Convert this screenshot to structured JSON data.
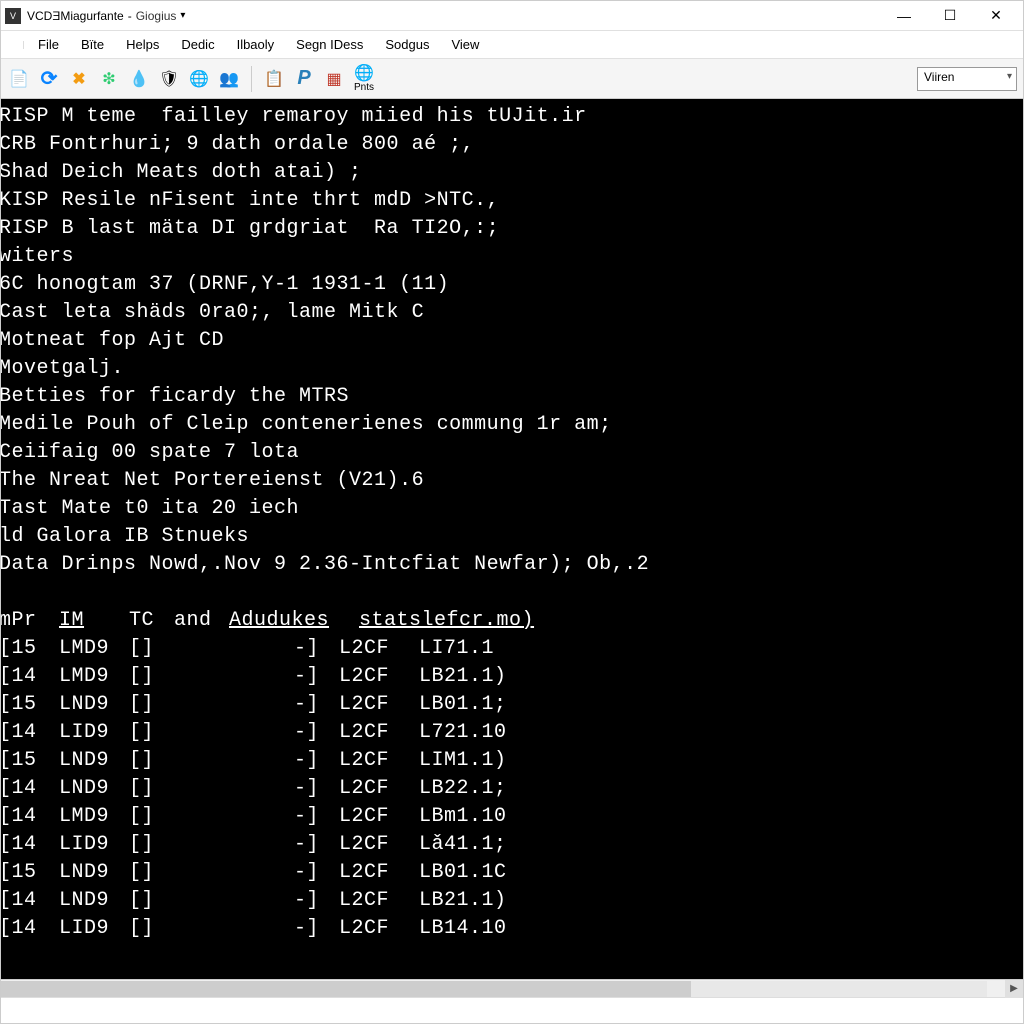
{
  "titlebar": {
    "app_icon_letter": "V",
    "title": "VCDƎMiagurfante",
    "subtitle": "Giogius",
    "caret": "▾"
  },
  "menubar": {
    "items": [
      "",
      "File",
      "Bïte",
      "Helps",
      "Dedic",
      "Ilbaoly",
      "Segn IDess",
      "Sodgus",
      "View"
    ]
  },
  "toolbar": {
    "icons": [
      {
        "name": "new-doc-icon",
        "glyph": "📄",
        "color": "#2a7"
      },
      {
        "name": "refresh-icon",
        "glyph": "⟳",
        "color": "#0a84ff"
      },
      {
        "name": "close-x-icon",
        "glyph": "✖",
        "color": "#f39c12"
      },
      {
        "name": "leaf-icon",
        "glyph": "❇",
        "color": "#2ecc71"
      },
      {
        "name": "drop-icon",
        "glyph": "💧",
        "color": "#3498db"
      },
      {
        "name": "shield-icon",
        "glyph": "🛡",
        "color": "#95a5a6"
      },
      {
        "name": "globe-icon",
        "glyph": "🌐",
        "color": "#8e44ad"
      },
      {
        "name": "people-icon",
        "glyph": "👥",
        "color": "#e67e22"
      }
    ],
    "icons2": [
      {
        "name": "calendar-icon",
        "glyph": "📋",
        "color": "#2980b9"
      },
      {
        "name": "p-icon",
        "glyph": "P",
        "color": "#2980b9"
      },
      {
        "name": "grid-icon",
        "glyph": "▦",
        "color": "#c0392b"
      }
    ],
    "prints_label": "Pnts",
    "prints_icon": "🌐",
    "select_value": "Viiren"
  },
  "terminal": {
    "lines": [
      "RISP M teme  failley remaroy miied his tUJit.ir",
      "CRB Fontrhuri; 9 dath ordale 800 aé ;,",
      "Shad Deich Meats doth atai) ;",
      "KISP Resile nFisent inte thrt mdD >NTC.,",
      "RISP B last mäta DI grdgriat  Ra TI2O,:;",
      "",
      "witers",
      "6C honogtam 37 (DRNF,Y-1 1931-1 (11)",
      "Cast leta shäds 0ra0;, lame Mitk C",
      "",
      "Motneat fop Ajt CD",
      "Movetgalj.",
      "Betties for ficardy the MTRS",
      "",
      "Medile Pouh of Cleip contenerienes commung 1r am;",
      "Ceiifaig 00 spate 7 lota",
      "The Nreat Net Portereienst (V21).6",
      "Tast Mate t0 ita 20 iech",
      "ld Galora IB Stnueks",
      "Data Drinps Nowd,.Nov 9 2.36-Intcfiat Newfar); Ob,.2"
    ],
    "table_header": [
      "mPr",
      "IM",
      "TC",
      "and",
      "Adudukes",
      "statslefcr.mo)"
    ],
    "rows": [
      [
        "[15",
        "LMD9",
        "[]",
        "",
        "-]",
        "L2CF",
        "LI71.1"
      ],
      [
        "[14",
        "LMD9",
        "[]",
        "",
        "-]",
        "L2CF",
        "LB21.1)"
      ],
      [
        "[15",
        "LND9",
        "[]",
        "",
        "-]",
        "L2CF",
        "LB01.1;"
      ],
      [
        "[14",
        "LID9",
        "[]",
        "",
        "-]",
        "L2CF",
        "L721.10"
      ],
      [
        "[15",
        "LND9",
        "[]",
        "",
        "-]",
        "L2CF",
        "LIM1.1)"
      ],
      [
        "[14",
        "LND9",
        "[]",
        "",
        "-]",
        "L2CF",
        "LB22.1;"
      ],
      [
        "[14",
        "LMD9",
        "[]",
        "",
        "-]",
        "L2CF",
        "LBm1.10"
      ],
      [
        "[14",
        "LID9",
        "[]",
        "",
        "-]",
        "L2CF",
        "Lǎ41.1;"
      ],
      [
        "[15",
        "LND9",
        "[]",
        "",
        "-]",
        "L2CF",
        "LB01.1C"
      ],
      [
        "[14",
        "LND9",
        "[]",
        "",
        "-]",
        "L2CF",
        "LB21.1)"
      ],
      [
        "[14",
        "LID9",
        "[]",
        "",
        "-]",
        "L2CF",
        "LB14.10"
      ]
    ]
  },
  "status": {
    "left": "",
    "right": ""
  }
}
